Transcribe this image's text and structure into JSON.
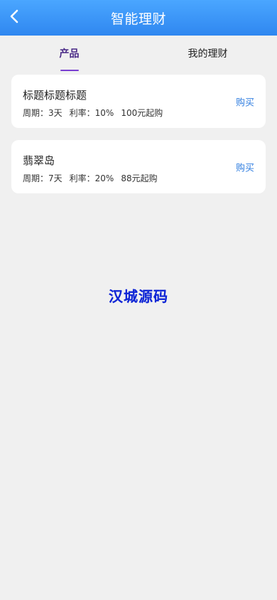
{
  "header": {
    "title": "智能理财",
    "back_icon": "chevron-left-icon"
  },
  "tabs": [
    {
      "label": "产品",
      "active": true
    },
    {
      "label": "我的理财",
      "active": false
    }
  ],
  "products": [
    {
      "title": "标题标题标题",
      "period": "周期：3天",
      "rate": "利率：10%",
      "min": "100元起购",
      "buy_label": "购买"
    },
    {
      "title": "翡翠岛",
      "period": "周期：7天",
      "rate": "利率：20%",
      "min": "88元起购",
      "buy_label": "购买"
    }
  ],
  "watermark": {
    "text": "汉城源码"
  },
  "colors": {
    "header_top": "#4aa6ff",
    "header_bottom": "#2f87f0",
    "tab_active": "#4a2a87",
    "tab_underline": "#7a3fd1",
    "buy": "#2f7de0",
    "watermark": "#1228d6",
    "background": "#f0f0f0"
  }
}
